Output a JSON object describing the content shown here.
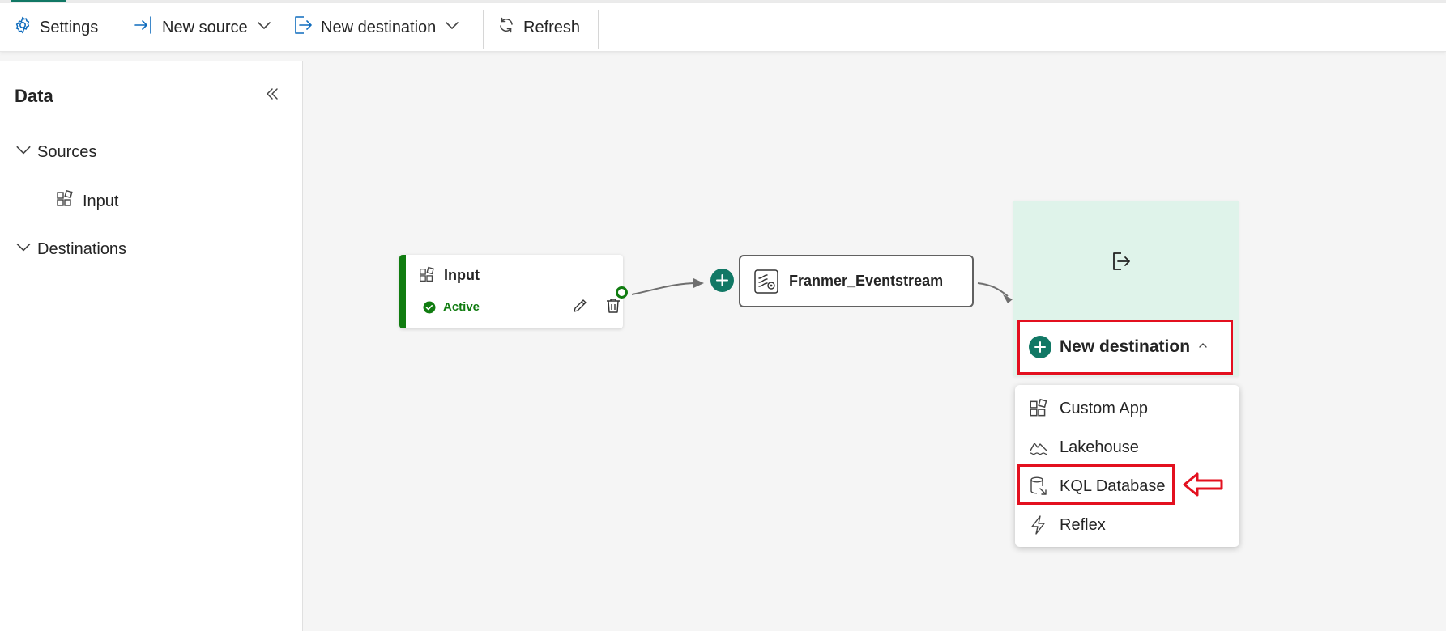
{
  "toolbar": {
    "settings_label": "Settings",
    "new_source_label": "New source",
    "new_destination_label": "New destination",
    "refresh_label": "Refresh"
  },
  "sidebar": {
    "title": "Data",
    "sources_label": "Sources",
    "source_items": [
      "Input"
    ],
    "destinations_label": "Destinations"
  },
  "canvas": {
    "input_node": {
      "title": "Input",
      "status": "Active"
    },
    "eventstream_node": {
      "title": "Franmer_Eventstream"
    },
    "new_destination_label": "New destination",
    "destination_menu": [
      "Custom App",
      "Lakehouse",
      "KQL Database",
      "Reflex"
    ]
  },
  "colors": {
    "accent": "#117865",
    "status_active": "#107c10",
    "highlight": "#e3101f",
    "destination_card": "#dff3ea"
  },
  "icons": [
    "gear-icon",
    "source-arrow-icon",
    "destination-arrow-icon",
    "chevron-down-icon",
    "refresh-icon",
    "collapse-icon",
    "custom-app-icon",
    "check-circle-icon",
    "edit-icon",
    "delete-icon",
    "eventstream-icon",
    "add-icon",
    "exit-icon",
    "chevron-up-icon",
    "lakehouse-icon",
    "database-icon",
    "lightning-icon",
    "arrow-left-icon"
  ]
}
